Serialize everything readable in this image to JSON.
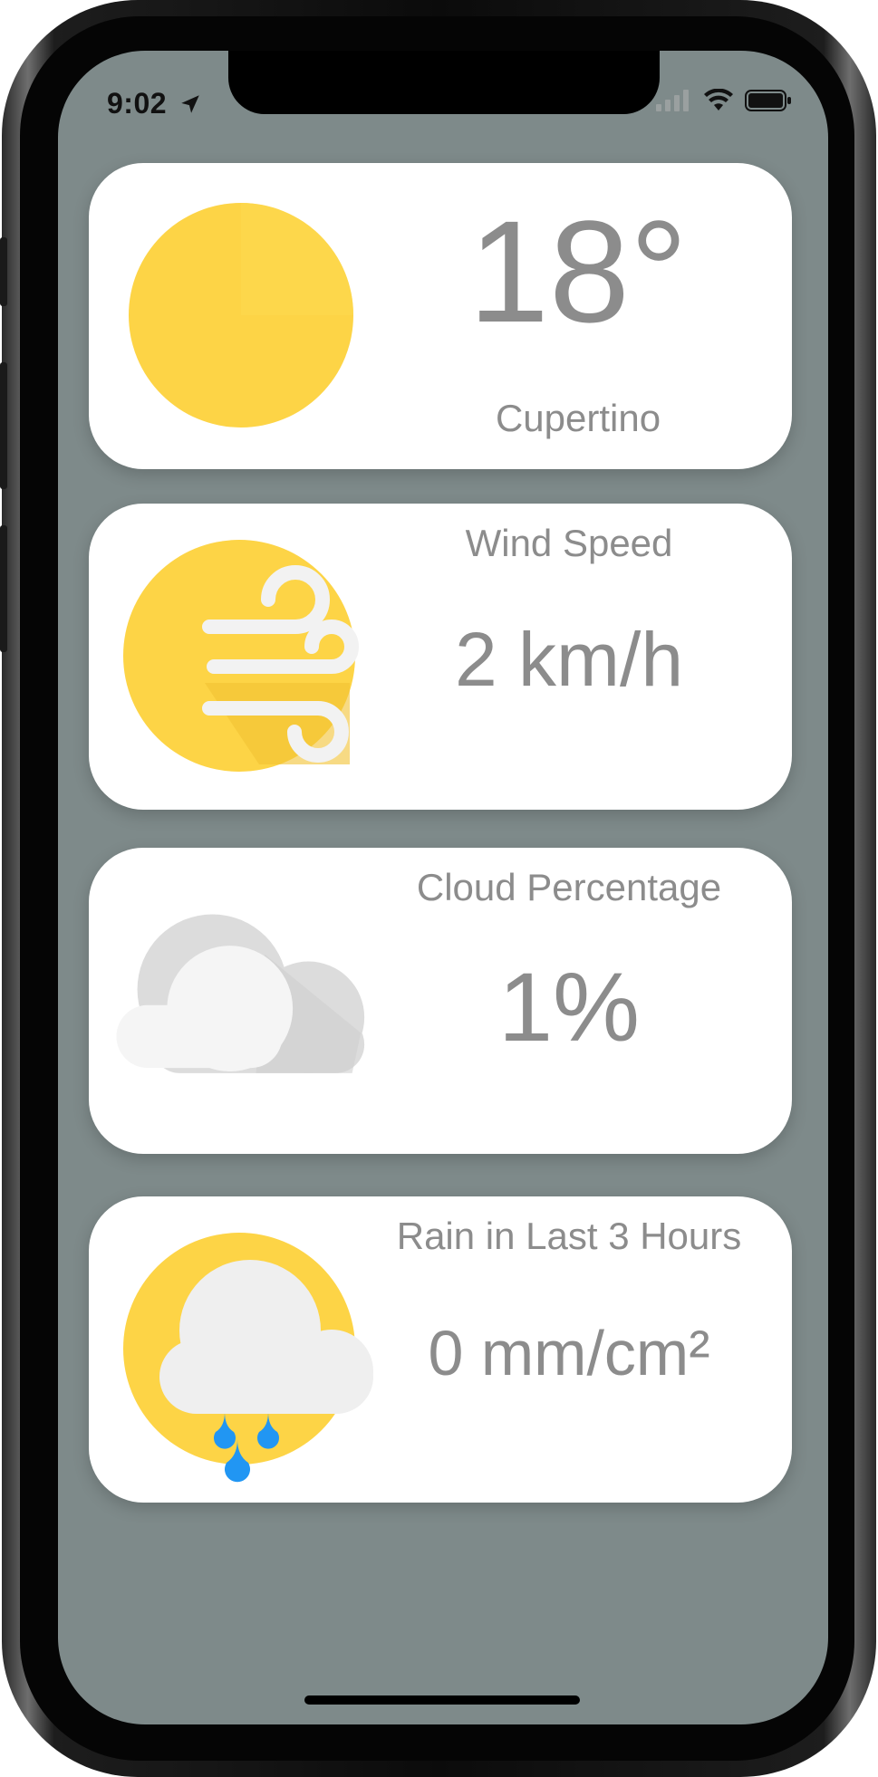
{
  "status_bar": {
    "time": "9:02",
    "location_icon": "location-arrow-icon",
    "signal_icon": "cellular-signal-icon",
    "wifi_icon": "wifi-icon",
    "battery_icon": "battery-icon"
  },
  "cards": {
    "temperature": {
      "value": "18°",
      "city": "Cupertino",
      "icon": "sun-icon"
    },
    "wind": {
      "label": "Wind Speed",
      "value": "2 km/h",
      "icon": "wind-icon"
    },
    "cloud": {
      "label": "Cloud Percentage",
      "value": "1%",
      "icon": "cloud-icon"
    },
    "rain": {
      "label": "Rain in Last 3 Hours",
      "value": "0 mm/cm²",
      "icon": "rain-cloud-sun-icon"
    }
  },
  "colors": {
    "screen_background": "#7e8a8a",
    "card_background": "#ffffff",
    "text_gray": "#8c8c8c",
    "sun_yellow": "#fdd446",
    "rain_blue": "#2196f3"
  }
}
